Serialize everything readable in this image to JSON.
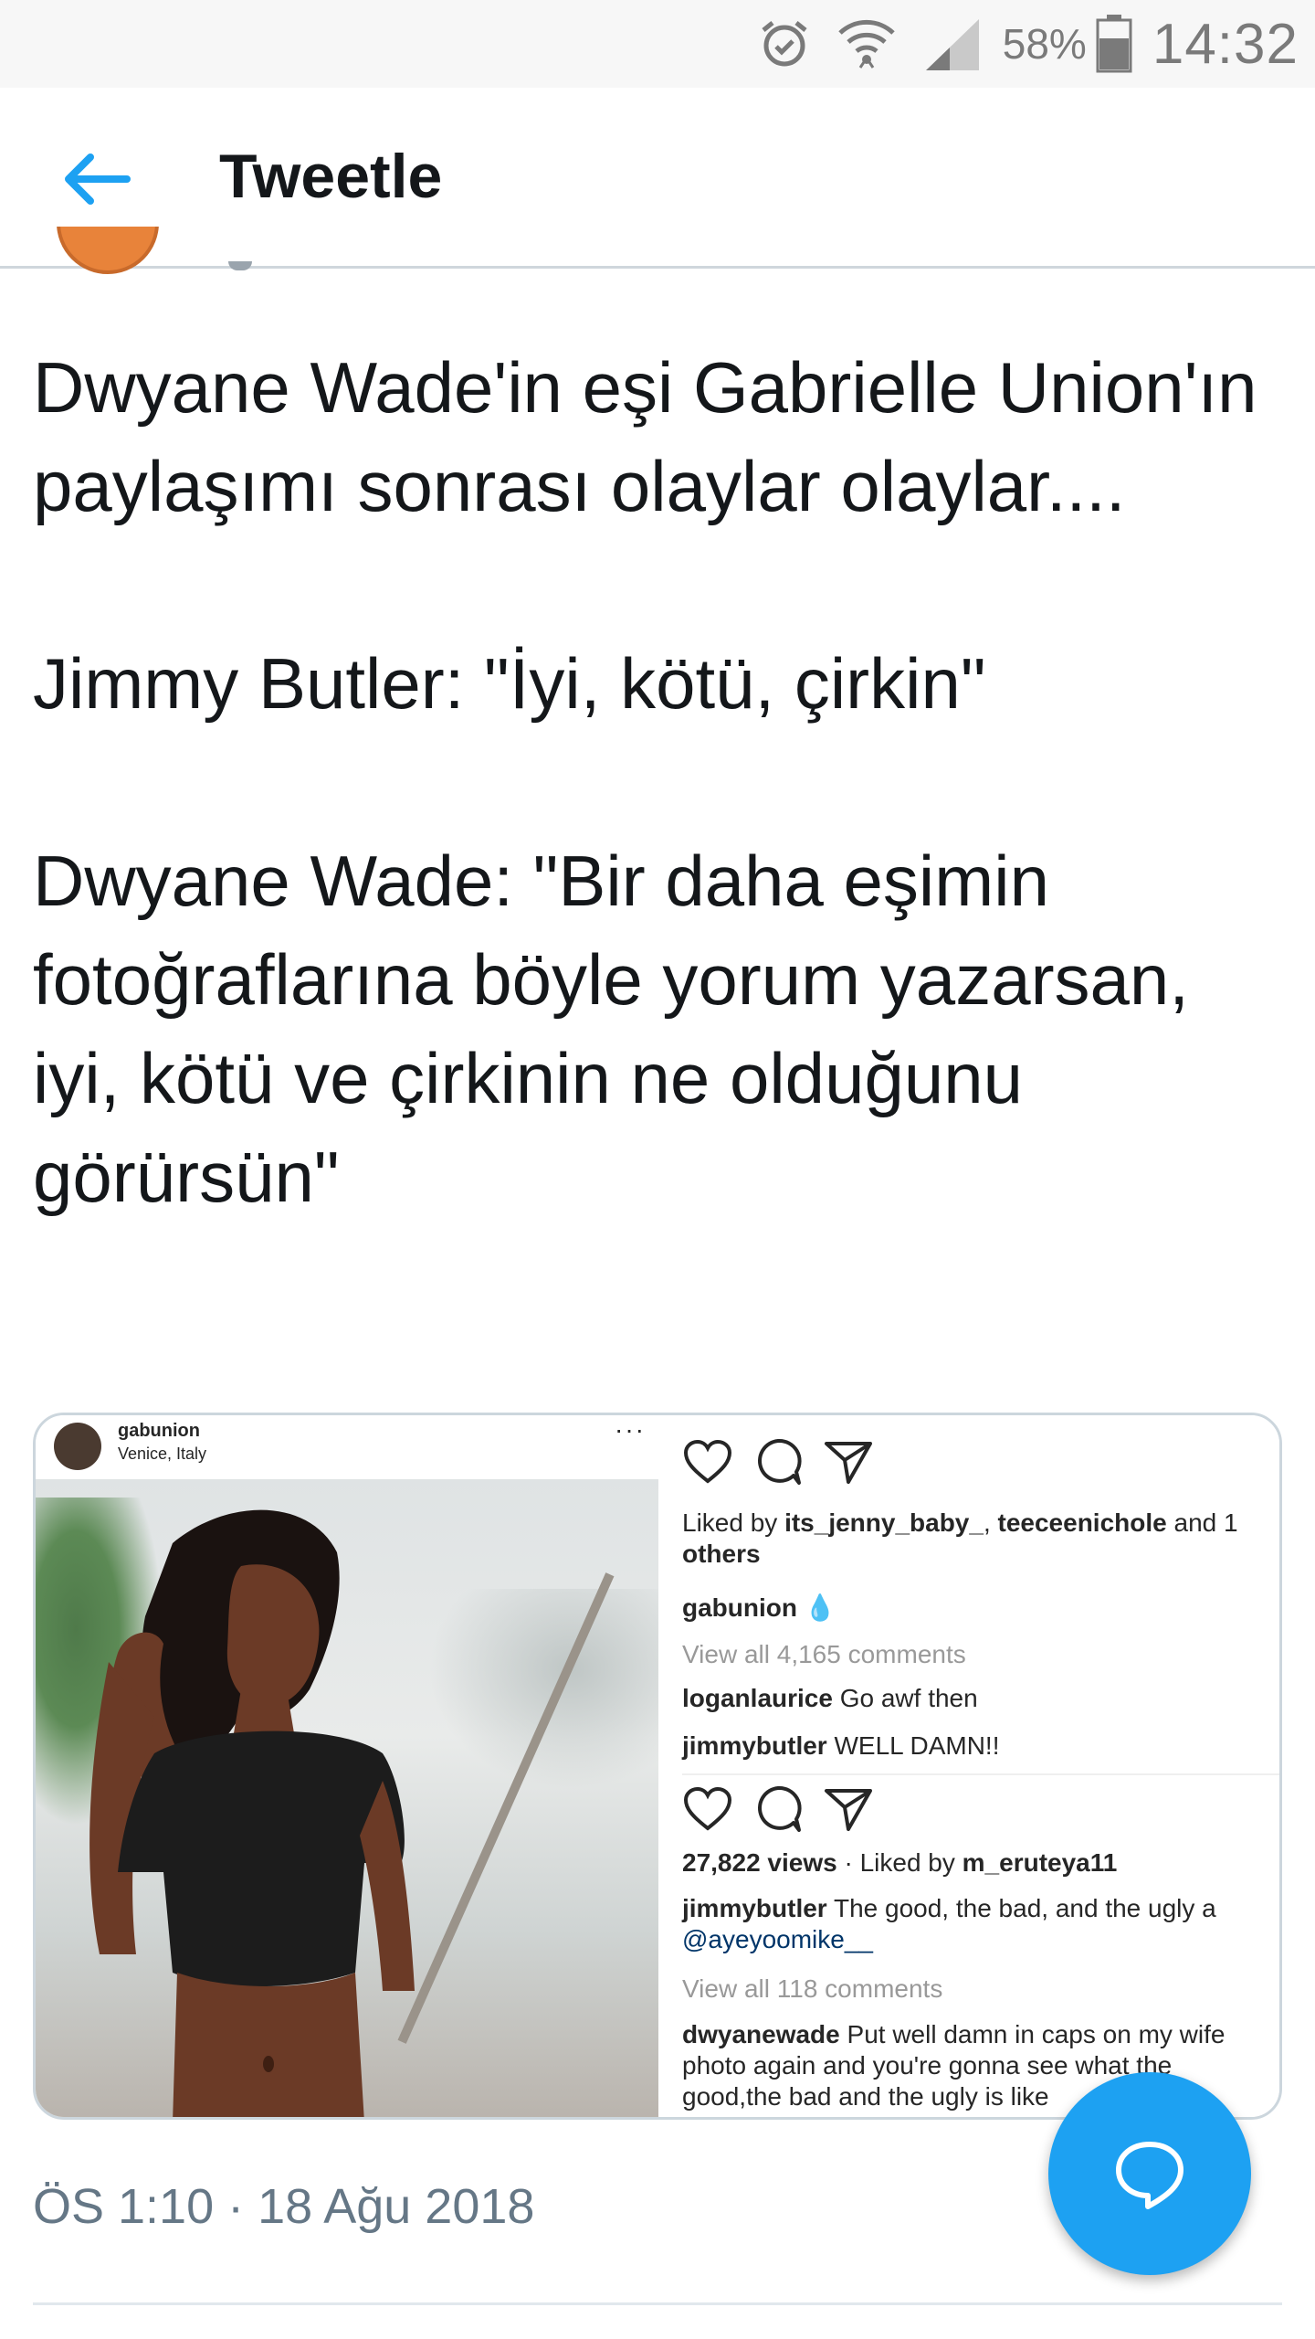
{
  "status_bar": {
    "battery_percent": "58%",
    "time": "14:32",
    "icons": [
      "alarm-icon",
      "wifi-icon",
      "signal-icon",
      "battery-icon"
    ]
  },
  "app_bar": {
    "back_icon": "arrow-left-icon",
    "title": "Tweetle",
    "accent_color": "#1da1f2"
  },
  "tweet": {
    "paragraphs": [
      "Dwyane Wade'in eşi Gabrielle Union'ın paylaşımı sonrası olaylar olaylar....",
      "Jimmy Butler: \"İyi, kötü, çirkin\"",
      "Dwyane Wade: \"Bir daha eşimin fotoğraflarına böyle yorum yazarsan, iyi, kötü ve çirkinin ne olduğunu görürsün\""
    ],
    "timestamp": "ÖS 1:10 · 18 Ağu 2018"
  },
  "embedded_image": {
    "header": {
      "username": "gabunion",
      "location": "Venice, Italy",
      "more": "···"
    },
    "post1": {
      "liked_by_prefix": "Liked by ",
      "liked_user1": "its_jenny_baby_",
      "liked_sep": ", ",
      "liked_user2": "teeceenichole",
      "liked_suffix": " and 1",
      "liked_others": "others",
      "caption_user": "gabunion",
      "view_comments": "View all 4,165 comments",
      "comment1_user": "loganlaurice",
      "comment1_text": " Go awf then",
      "comment2_user": "jimmybutler",
      "comment2_text": " WELL DAMN!!"
    },
    "post2": {
      "views": "27,822 views",
      "liked_by_text": " · Liked by ",
      "liked_user": "m_eruteya11",
      "comment1_user": "jimmybutler",
      "comment1_text": " The good, the bad, and the ugly a",
      "mention": "@ayeyoomike__",
      "view_comments": "View all 118 comments",
      "comment2_user": "dwyanewade",
      "comment2_line1": " Put well damn in caps on my wife",
      "comment2_line2": "photo again and you're gonna see what the",
      "comment2_line3": "good,the bad and the ugly is like"
    }
  },
  "fab": {
    "icon": "compose-reply-icon"
  }
}
